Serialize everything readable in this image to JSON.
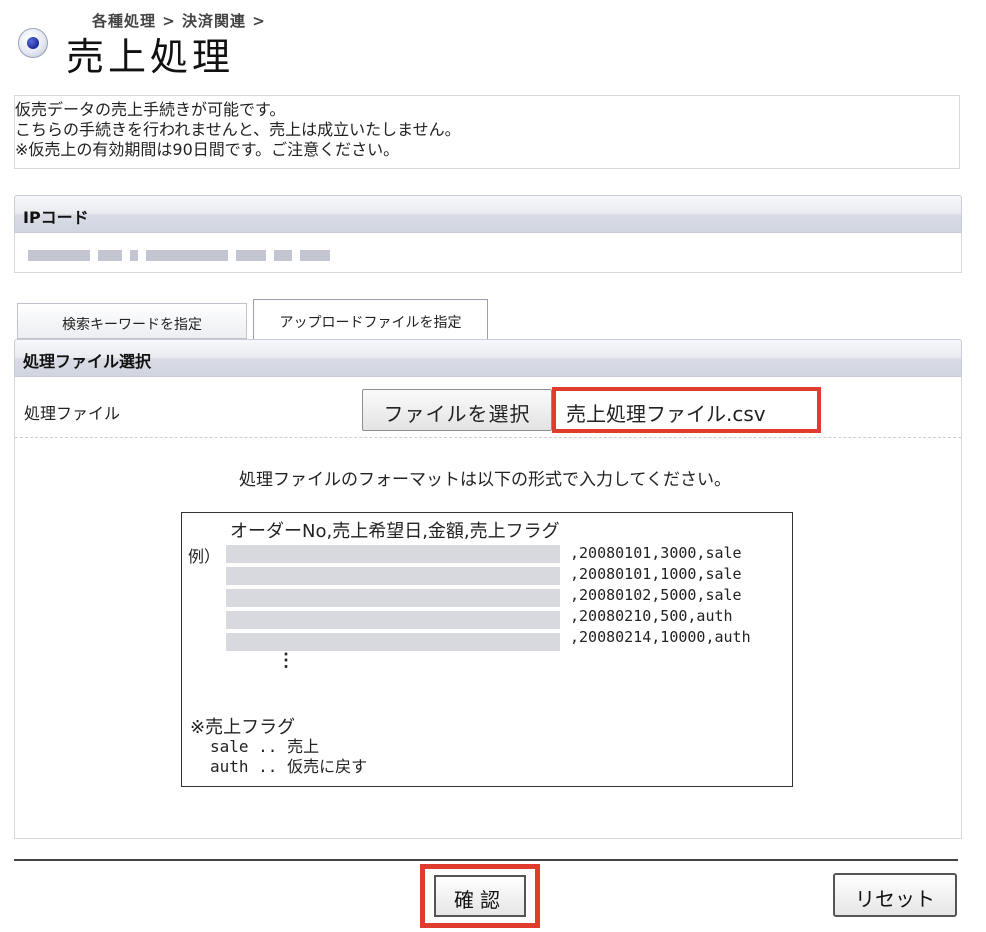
{
  "breadcrumb": "各種処理 > 決済関連 >",
  "page_title": "売上処理",
  "bullet_icon": "radio-bullet-icon",
  "info_lines": [
    "仮売データの売上手続きが可能です。",
    "こちらの手続きを行われませんと、売上は成立いたしません。",
    "※仮売上の有効期間は90日間です。ご注意ください。"
  ],
  "ip_section": {
    "label": "IPコード",
    "value_hidden": true
  },
  "tabs": [
    {
      "label": "検索キーワードを指定",
      "active": false
    },
    {
      "label": "アップロードファイルを指定",
      "active": true
    }
  ],
  "process_section": {
    "header": "処理ファイル選択",
    "row_label": "処理ファイル",
    "file_button": "ファイルを選択",
    "file_name": "売上処理ファイル.csv",
    "instruction": "処理ファイルのフォーマットは以下の形式で入力してください。"
  },
  "sample": {
    "header": "オーダーNo,売上希望日,金額,売上フラグ",
    "example_label": "例）",
    "rows": [
      ",20080101,3000,sale",
      ",20080101,1000,sale",
      ",20080102,5000,sale",
      ",20080210,500,auth",
      ",20080214,10000,auth"
    ],
    "ellipsis": "⋮",
    "flag_title": "※売上フラグ",
    "flags": [
      "sale .. 売上",
      "auth .. 仮売に戻す"
    ]
  },
  "buttons": {
    "confirm": "確認",
    "reset": "リセット"
  },
  "colors": {
    "highlight": "#e03c2d",
    "bar_top": "#f7f8fb",
    "bar_bottom": "#d1d5df"
  }
}
